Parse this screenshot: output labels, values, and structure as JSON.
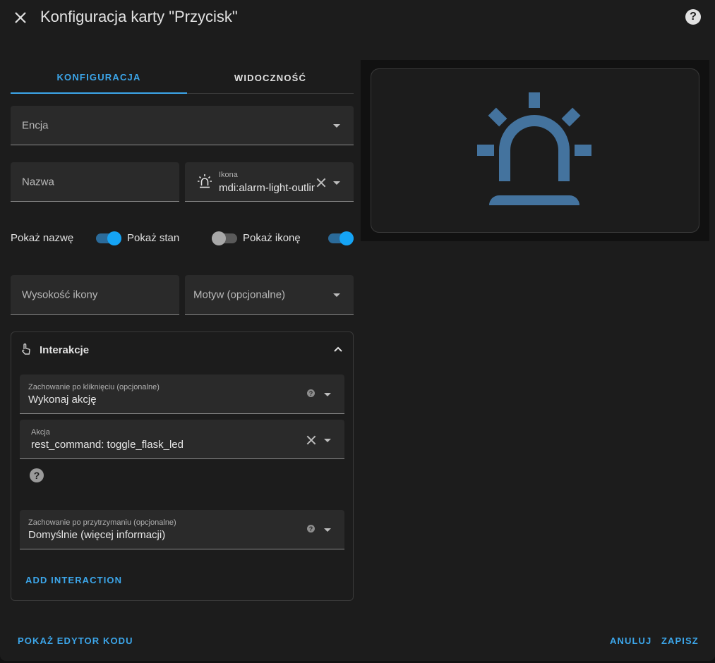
{
  "dialog": {
    "title": "Konfiguracja karty \"Przycisk\"",
    "close_icon": "close-icon",
    "help_icon": "help-icon"
  },
  "tabs": [
    {
      "label": "KONFIGURACJA",
      "active": true
    },
    {
      "label": "WIDOCZNOŚĆ",
      "active": false
    }
  ],
  "form": {
    "entity": {
      "label": "Encja"
    },
    "name": {
      "label": "Nazwa"
    },
    "icon": {
      "label": "Ikona",
      "value": "mdi:alarm-light-outline",
      "icon": "alarm-light-outline-icon"
    },
    "toggles": [
      {
        "label": "Pokaż nazwę",
        "on": true
      },
      {
        "label": "Pokaż stan",
        "on": false
      },
      {
        "label": "Pokaż ikonę",
        "on": true
      }
    ],
    "icon_height": {
      "label": "Wysokość ikony"
    },
    "theme": {
      "label": "Motyw (opcjonalne)"
    }
  },
  "interactions": {
    "title": "Interakcje",
    "tap_action": {
      "label": "Zachowanie po kliknięciu (opcjonalne)",
      "value": "Wykonaj akcję"
    },
    "action": {
      "label": "Akcja",
      "value": "rest_command: toggle_flask_led"
    },
    "hold_action": {
      "label": "Zachowanie po przytrzymaniu (opcjonalne)",
      "value": "Domyślnie (więcej informacji)"
    },
    "add_button": "ADD INTERACTION"
  },
  "preview": {
    "icon": "alarm-light-outline-icon",
    "icon_color": "#44739e"
  },
  "footer": {
    "code_editor": "POKAŻ EDYTOR KODU",
    "cancel": "ANULUJ",
    "save": "ZAPISZ"
  },
  "colors": {
    "accent": "#3ca6ea",
    "background": "#1c1c1c",
    "field": "#2a2a2a"
  }
}
